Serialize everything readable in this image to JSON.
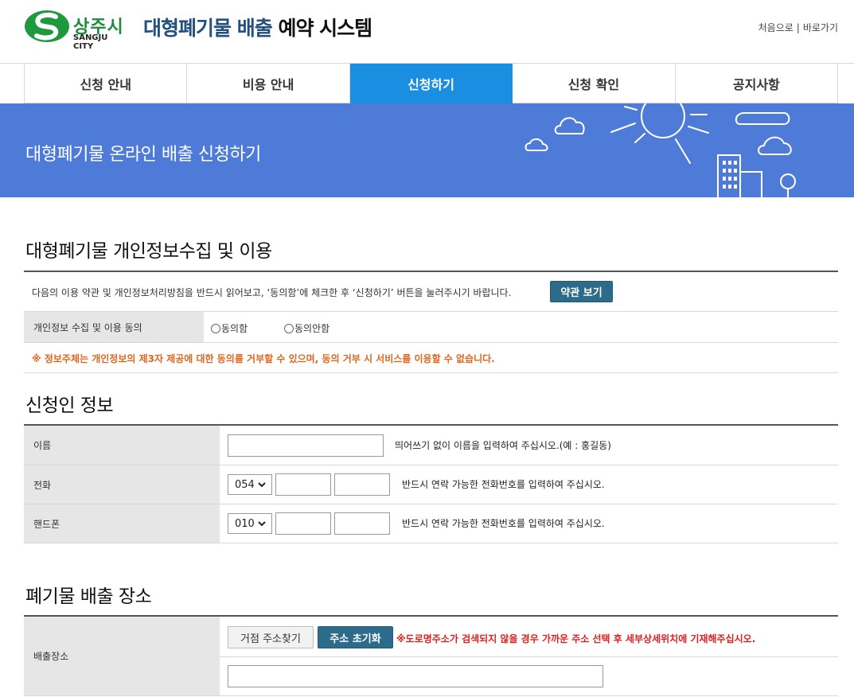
{
  "header": {
    "logo_korean": "상주시",
    "logo_english": "SANGJU CITY",
    "title_blue": "대형폐기물 배출",
    "title_dark": "예약 시스템",
    "links": [
      "처음으로",
      "바로가기"
    ],
    "separator": "|"
  },
  "nav": {
    "items": [
      "신청 안내",
      "비용 안내",
      "신청하기",
      "신청 확인",
      "공지사항"
    ],
    "active_index": 2
  },
  "banner": {
    "title": "대형폐기물 온라인 배출 신청하기"
  },
  "privacy": {
    "section_title": "대형폐기물 개인정보수집 및 이용",
    "notice": "다음의 이용 약관 및 개인정보처리방침을 반드시 읽어보고, ‘동의함’에 체크한 후 ‘신청하기’ 버튼을 눌러주시기 바랍니다.",
    "terms_button": "약관 보기",
    "consent_label": "개인정보 수집 및 이용 동의",
    "agree_label": "동의함",
    "disagree_label": "동의안함",
    "warning": "※ 정보주체는 개인정보의 제3자 제공에 대한 동의를 거부할 수 있으며, 동의 거부 시 서비스를 이용할 수 없습니다."
  },
  "applicant": {
    "section_title": "신청인 정보",
    "name_label": "이름",
    "name_value": "",
    "name_help": "띄어쓰기 없이 이름을 입력하여 주십시오.(예 : 홍길동)",
    "phone_label": "전화",
    "phone_prefix": "054",
    "phone_help": "반드시 연락 가능한 전화번호를 입력하여 주십시오.",
    "mobile_label": "핸드폰",
    "mobile_prefix": "010",
    "mobile_help": "반드시 연락 가능한 전화번호를 입력하여 주십시오."
  },
  "location": {
    "section_title": "폐기물 배출 장소",
    "label": "배출장소",
    "search_button": "거점 주소찾기",
    "reset_button": "주소 초기화",
    "warning": "※도로명주소가 검색되지 않을 경우 가까운 주소 선택 후 세부상세위치에 기재해주십시오.",
    "address_value": ""
  }
}
